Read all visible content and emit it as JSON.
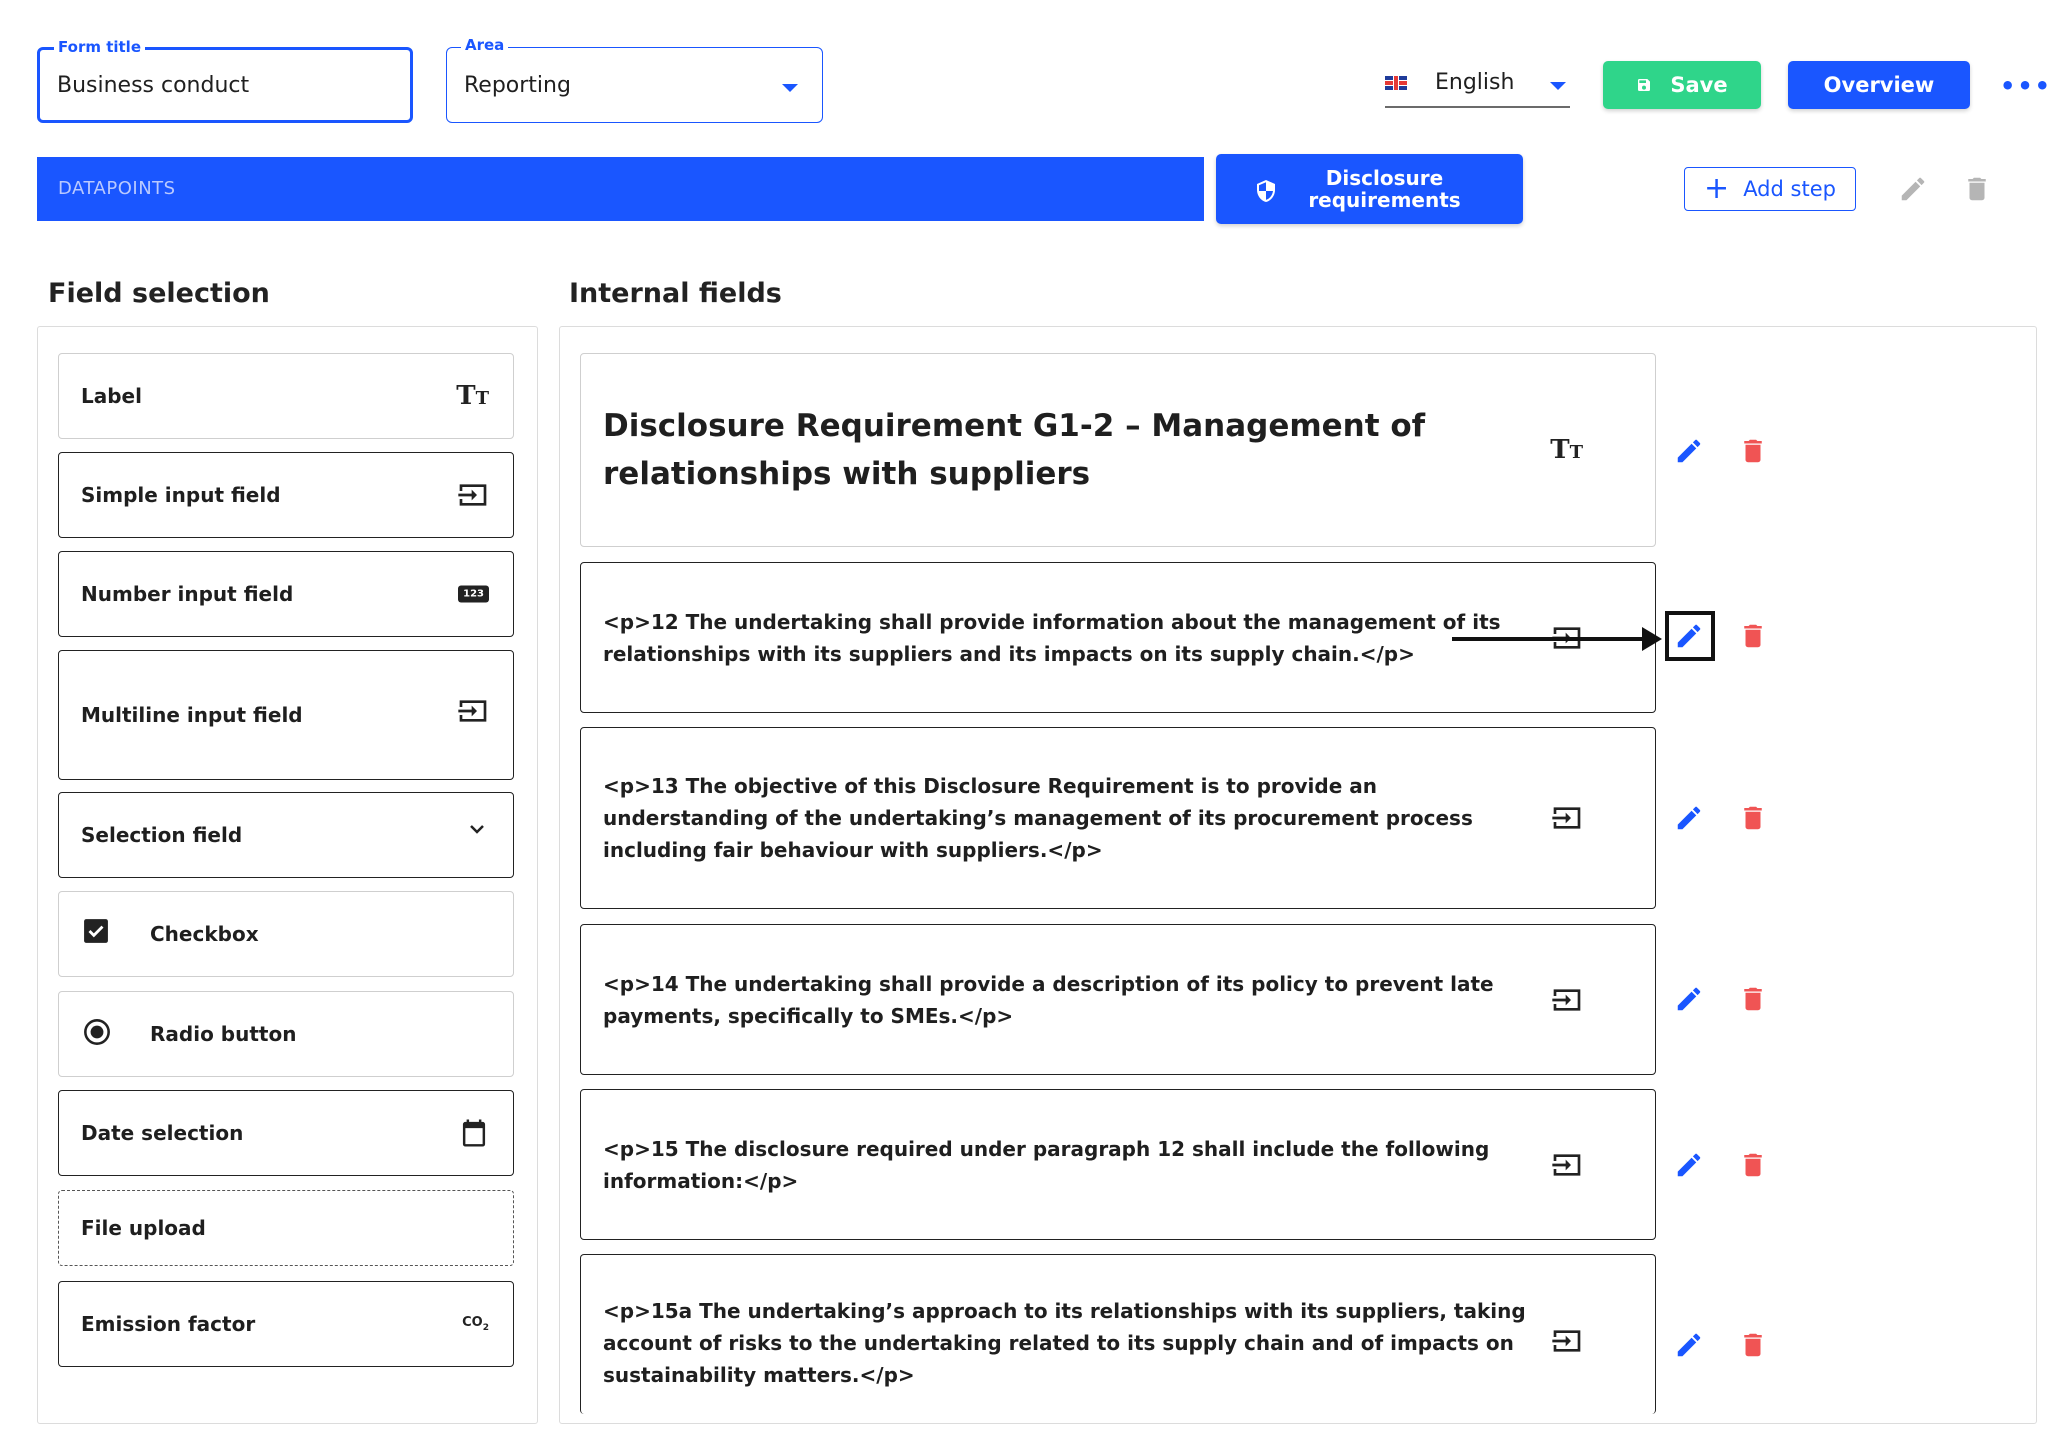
{
  "header": {
    "form_title": {
      "legend": "Form title",
      "value": "Business conduct"
    },
    "area": {
      "legend": "Area",
      "value": "Reporting"
    },
    "language": {
      "value": "English",
      "flag": "uk-flag-icon"
    },
    "save_label": "Save",
    "overview_label": "Overview",
    "more_label": "•••"
  },
  "toolbar": {
    "datapoints_label": "DATAPOINTS",
    "disclosure_line1": "Disclosure",
    "disclosure_line2": "requirements",
    "add_step_label": "Add step"
  },
  "field_selection": {
    "title": "Field selection",
    "items": [
      {
        "label": "Label",
        "icon": "text-format-icon",
        "glyph": "Tᴛ"
      },
      {
        "label": "Simple input field",
        "icon": "input-icon"
      },
      {
        "label": "Number input field",
        "icon": "numbers-icon",
        "glyph": "123"
      },
      {
        "label": "Multiline input field",
        "icon": "input-icon"
      },
      {
        "label": "Selection field",
        "icon": "chevron-down-icon"
      },
      {
        "label": "Checkbox",
        "icon": "checkbox-icon"
      },
      {
        "label": "Radio button",
        "icon": "radio-icon"
      },
      {
        "label": "Date selection",
        "icon": "calendar-icon"
      },
      {
        "label": "File upload",
        "icon": ""
      },
      {
        "label": "Emission factor",
        "icon": "co2-icon",
        "glyph": "CO₂"
      }
    ]
  },
  "internal_fields": {
    "title": "Internal fields",
    "items": [
      {
        "text": "Disclosure Requirement G1-2 – Management of relationships with suppliers",
        "icon": "text-format-icon"
      },
      {
        "text": "<p>12 The undertaking shall provide information about the management of its relationships with its suppliers and its impacts on its supply chain.</p>",
        "icon": "input-icon"
      },
      {
        "text": "<p>13 The objective of this Disclosure Requirement is to provide an understanding of the undertaking’s management of its procurement process including fair behaviour with suppliers.</p>",
        "icon": "input-icon"
      },
      {
        "text": "<p>14 The undertaking shall provide a description of its policy to prevent late payments, specifically to SMEs.</p>",
        "icon": "input-icon"
      },
      {
        "text": "<p>15 The disclosure required under paragraph 12 shall include the following information:</p>",
        "icon": "input-icon"
      },
      {
        "text": "<p>15a The undertaking’s approach to its relationships with its suppliers, taking account of risks to the undertaking related to its supply chain and of impacts on sustainability matters.</p>",
        "icon": "input-icon"
      }
    ]
  },
  "colors": {
    "primary": "#1a56ff",
    "save": "#2fd58a",
    "delete": "#f05454",
    "disabled": "#b5b5b5"
  }
}
